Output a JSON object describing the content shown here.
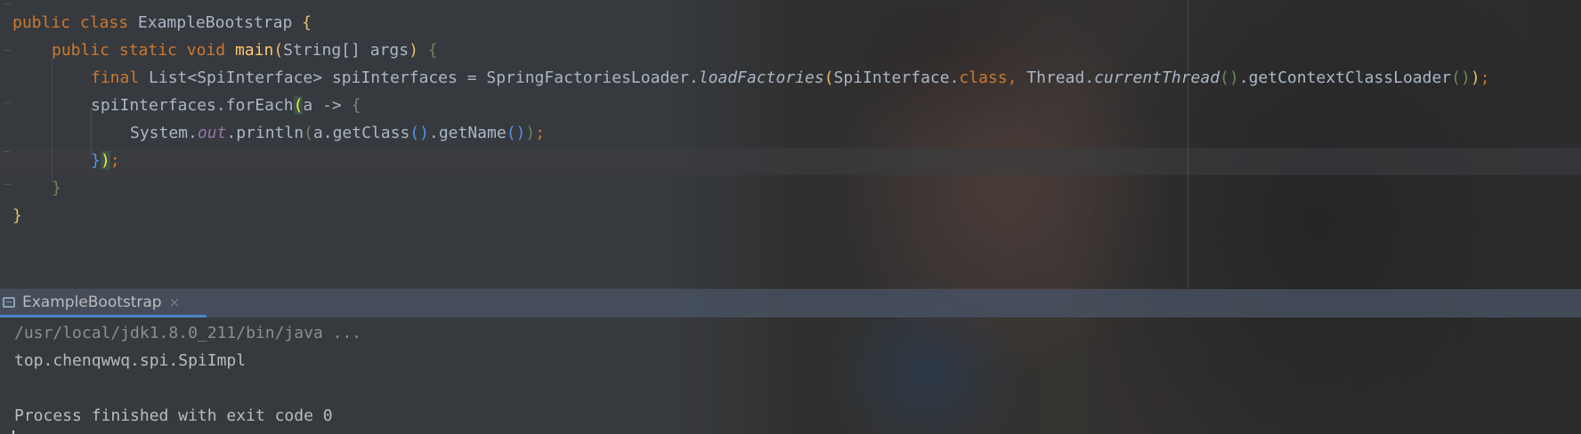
{
  "editor": {
    "lines": [
      {
        "id": "class-decl"
      },
      {
        "id": "main-decl"
      },
      {
        "id": "loader-line"
      },
      {
        "id": "foreach-line"
      },
      {
        "id": "println-line"
      },
      {
        "id": "close-lambda"
      },
      {
        "id": "close-method"
      },
      {
        "id": "close-class"
      }
    ],
    "tokens": {
      "public": "public",
      "class": "class",
      "class_name": "ExampleBootstrap",
      "open_brace": "{",
      "close_brace": "}",
      "static": "static",
      "void": "void",
      "main": "main",
      "string_array": "String[]",
      "args": "args",
      "final": "final",
      "list_type": "List<SpiInterface>",
      "var_name": "spiInterfaces",
      "equals": "=",
      "loader_class": "SpringFactoriesLoader.",
      "load_factories": "loadFactories",
      "spi_interface_dot": "SpiInterface.",
      "class_kw": "class",
      "comma": ",",
      "thread_dot": "Thread.",
      "current_thread": "currentThread",
      "get_context": ".getContextClassLoader",
      "foreach_call": "spiInterfaces.forEach",
      "lambda": "a ->",
      "system_dot": "System.",
      "out": "out",
      "println": ".println",
      "a_get_class": "a.getClass",
      "get_name": ".getName",
      "semicolon": ";"
    }
  },
  "run_panel": {
    "tab_label": "ExampleBootstrap",
    "close_glyph": "×",
    "console": {
      "command": "/usr/local/jdk1.8.0_211/bin/java ...",
      "output": "top.chenqwwq.spi.SpiImpl",
      "exit": "Process finished with exit code 0"
    }
  },
  "colors": {
    "keyword": "#cc7832",
    "method": "#ffc66d",
    "static_field": "#9876aa",
    "text": "#a9b7c6",
    "tab_underline": "#4a88c7"
  }
}
